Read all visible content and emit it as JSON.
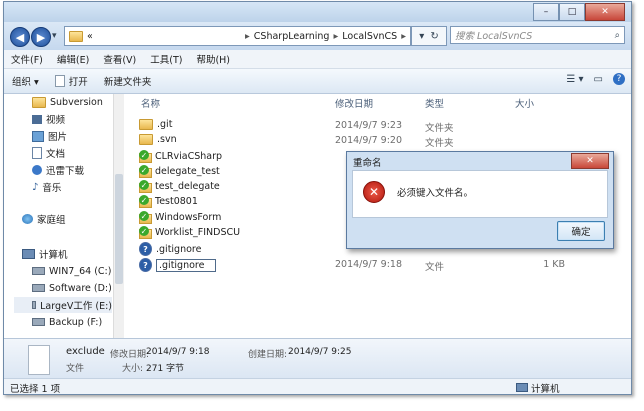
{
  "window": {
    "min": "–",
    "max": "□",
    "close": "✕"
  },
  "nav": {
    "back": "◀",
    "forward": "▶",
    "dropdown": "▾",
    "path": [
      "«",
      "CSharpLearning",
      "LocalSvnCS"
    ],
    "sep": "▸",
    "refresh": "↻",
    "search_placeholder": "搜索 LocalSvnCS"
  },
  "menu": [
    "文件(F)",
    "编辑(E)",
    "查看(V)",
    "工具(T)",
    "帮助(H)"
  ],
  "toolbar": {
    "organize": "组织 ▾",
    "open": "打开",
    "new_folder": "新建文件夹"
  },
  "sidebar": [
    {
      "label": "Subversion",
      "icon": "folder-icon"
    },
    {
      "label": "视频",
      "icon": "video-icon"
    },
    {
      "label": "图片",
      "icon": "picture-icon"
    },
    {
      "label": "文档",
      "icon": "document-icon"
    },
    {
      "label": "迅雷下载",
      "icon": "download-icon"
    },
    {
      "label": "音乐",
      "icon": "music-icon"
    },
    {
      "label": "家庭组",
      "icon": "homegroup-icon"
    },
    {
      "label": "计算机",
      "icon": "computer-icon"
    },
    {
      "label": "WIN7_64 (C:)",
      "icon": "drive-icon"
    },
    {
      "label": "Software (D:)",
      "icon": "drive-icon"
    },
    {
      "label": "LargeV工作 (E:)",
      "icon": "drive-icon"
    },
    {
      "label": "Backup (F:)",
      "icon": "drive-icon"
    }
  ],
  "columns": {
    "name": "名称",
    "date": "修改日期",
    "type": "类型",
    "size": "大小"
  },
  "files": [
    {
      "name": ".git",
      "date": "2014/9/7 9:23",
      "type": "文件夹",
      "size": "",
      "icon": "folder"
    },
    {
      "name": ".svn",
      "date": "2014/9/7 9:20",
      "type": "文件夹",
      "size": "",
      "icon": "folder"
    },
    {
      "name": "CLRviaCSharp",
      "date": "",
      "type": "",
      "size": "",
      "icon": "svn"
    },
    {
      "name": "delegate_test",
      "date": "",
      "type": "",
      "size": "",
      "icon": "svn"
    },
    {
      "name": "test_delegate",
      "date": "",
      "type": "",
      "size": "",
      "icon": "svn"
    },
    {
      "name": "Test0801",
      "date": "",
      "type": "",
      "size": "",
      "icon": "svn"
    },
    {
      "name": "WindowsForm",
      "date": "",
      "type": "",
      "size": "",
      "icon": "svn"
    },
    {
      "name": "Worklist_FINDSCU",
      "date": "",
      "type": "",
      "size": "",
      "icon": "svn"
    },
    {
      "name": ".gitignore",
      "date": "",
      "type": "",
      "size": "",
      "icon": "file"
    },
    {
      "name": ".gitignore",
      "date": "2014/9/7 9:18",
      "type": "文件",
      "size": "1 KB",
      "icon": "file"
    }
  ],
  "details": {
    "filename": "exclude",
    "modified_label": "修改日期:",
    "modified": "2014/9/7 9:18",
    "created_label": "创建日期:",
    "created": "2014/9/7 9:25",
    "type": "文件",
    "size_label": "大小:",
    "size": "271 字节"
  },
  "status": {
    "selected": "已选择 1 项",
    "location": "计算机"
  },
  "dialog": {
    "title": "重命名",
    "message": "必须键入文件名。",
    "ok": "确定",
    "close": "✕",
    "error_glyph": "✕"
  },
  "toolbar_right": {
    "view": "☰ ▾",
    "pane": "▭",
    "help": "?"
  }
}
